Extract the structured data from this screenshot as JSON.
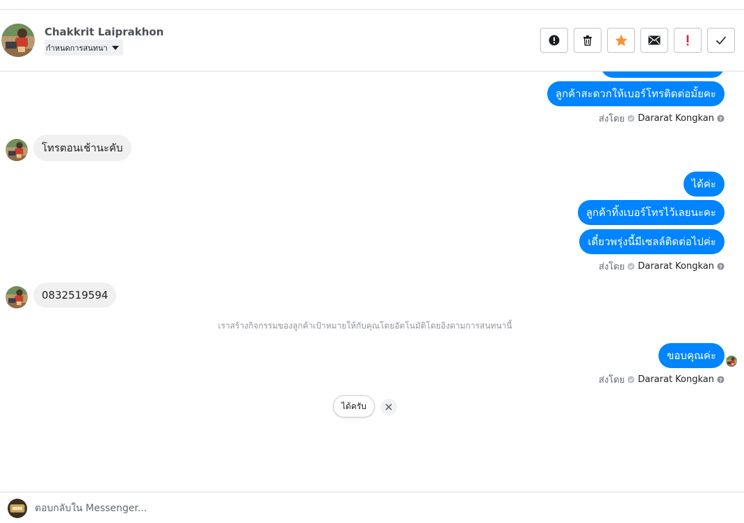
{
  "header": {
    "contact_name": "Chakkrit Laiprakhon",
    "assign_label": "กำหนดการสนทนา",
    "actions": [
      {
        "name": "report-spam-button",
        "icon": "alert-circle-icon"
      },
      {
        "name": "delete-button",
        "icon": "trash-icon"
      },
      {
        "name": "star-button",
        "icon": "star-icon"
      },
      {
        "name": "mark-unread-button",
        "icon": "envelope-icon"
      },
      {
        "name": "follow-up-button",
        "icon": "exclamation-icon"
      },
      {
        "name": "mark-done-button",
        "icon": "check-icon"
      }
    ]
  },
  "thread": {
    "outgoing_1_partial": "",
    "outgoing_1": "ลูกค้าสะดวกให้เบอร์โทรติดต่อมั้ยคะ",
    "sent_by_prefix": "ส่งโดย",
    "agent_name": "Dararat Kongkan",
    "incoming_1": "โทรตอนเช้านะคับ",
    "outgoing_2": "ได้ค่ะ",
    "outgoing_3": "ลูกค้าทิ้งเบอร์โทรไว้เลยนะคะ",
    "outgoing_4": "เดี๋ยวพรุ่งนี้มีเซลล์ติดต่อไปค่ะ",
    "incoming_2": "0832519594",
    "system_note": "เราสร้างกิจกรรมของลูกค้าเป้าหมายให้กับคุณโดยอัตโนมัติโดยอิงตามการสนทนานี้",
    "outgoing_5": "ขอบคุณค่ะ"
  },
  "quick_reply": {
    "label": "ได้ครับ"
  },
  "composer": {
    "placeholder": "ตอบกลับใน Messenger...",
    "value": ""
  },
  "colors": {
    "outgoing_bubble": "#0084ff",
    "incoming_bubble": "#f1f0f0",
    "star": "#f7923b",
    "flag": "#e41e3f"
  }
}
